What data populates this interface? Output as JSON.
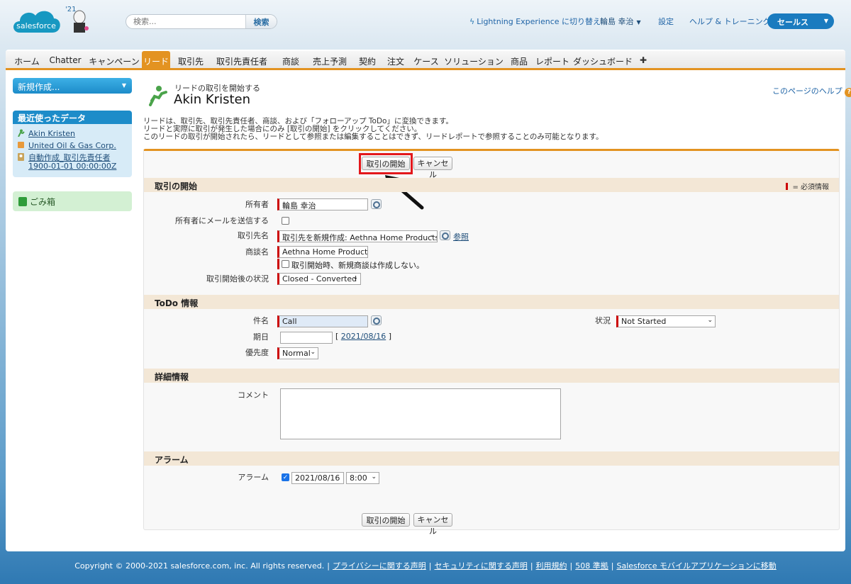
{
  "header": {
    "logo_text": "salesforce",
    "badge": "'21",
    "search_placeholder": "検索...",
    "search_button": "検索",
    "lightning_link": "Lightning Experience に切り替え",
    "user_name": "輪島 幸治",
    "setup": "設定",
    "help_training": "ヘルプ & トレーニング",
    "app_name": "セールス"
  },
  "tabs": [
    "ホーム",
    "Chatter",
    "キャンペーン",
    "リード",
    "取引先",
    "取引先責任者",
    "商談",
    "売上予測",
    "契約",
    "注文",
    "ケース",
    "ソリューション",
    "商品",
    "レポート",
    "ダッシュボード",
    "✚"
  ],
  "active_tab": "リード",
  "sidebar": {
    "create_new": "新規作成...",
    "recent_title": "最近使ったデータ",
    "recent_items": [
      "Akin Kristen",
      "United Oil & Gas Corp.",
      "自動作成_取引先責任者",
      "1900-01-01 00:00:00Z"
    ],
    "trash": "ごみ箱"
  },
  "page": {
    "subtitle": "リードの取引を開始する",
    "title": "Akin Kristen",
    "help_link": "このページのヘルプ",
    "instructions": [
      "リードは、取引先、取引先責任者、商談、および「フォローアップ ToDo」に変換できます。",
      "リードと実際に取引が発生した場合にのみ [取引の開始] をクリックしてください。",
      "このリードの取引が開始されたら、リードとして参照または編集することはできず、リードレポートで参照することのみ可能となります。"
    ]
  },
  "buttons": {
    "convert": "取引の開始",
    "cancel": "キャンセル"
  },
  "sections": {
    "convert": {
      "title": "取引の開始",
      "required_legend": "= 必須情報",
      "owner_label": "所有者",
      "owner_value": "輪島 幸治",
      "email_label": "所有者にメールを送信する",
      "account_label": "取引先名",
      "account_value": "取引先を新規作成: Aethna Home Products",
      "view_link": "参照",
      "opportunity_label": "商談名",
      "opportunity_value": "Aethna Home Products-",
      "no_opportunity_text": "取引開始時、新規商談は作成しない。",
      "status_label": "取引開始後の状況",
      "status_value": "Closed - Converted"
    },
    "todo": {
      "title": "ToDo 情報",
      "subject_label": "件名",
      "subject_value": "Call",
      "due_label": "期日",
      "due_date": "2021/08/16",
      "priority_label": "優先度",
      "priority_value": "Normal",
      "status_label": "状況",
      "status_value": "Not Started"
    },
    "details": {
      "title": "詳細情報",
      "comment_label": "コメント"
    },
    "alarm": {
      "title": "アラーム",
      "label": "アラーム",
      "date": "2021/08/16",
      "time": "8:00"
    }
  },
  "footer": {
    "copyright": "Copyright © 2000-2021 salesforce.com, inc. All rights reserved.",
    "links": [
      "プライバシーに関する声明",
      "セキュリティに関する声明",
      "利用規約",
      "508 準拠",
      "Salesforce モバイルアプリケーションに移動"
    ]
  },
  "colors": {
    "accent": "#e39321",
    "brand": "#1a7bbf",
    "annotation": "#e3181c"
  }
}
